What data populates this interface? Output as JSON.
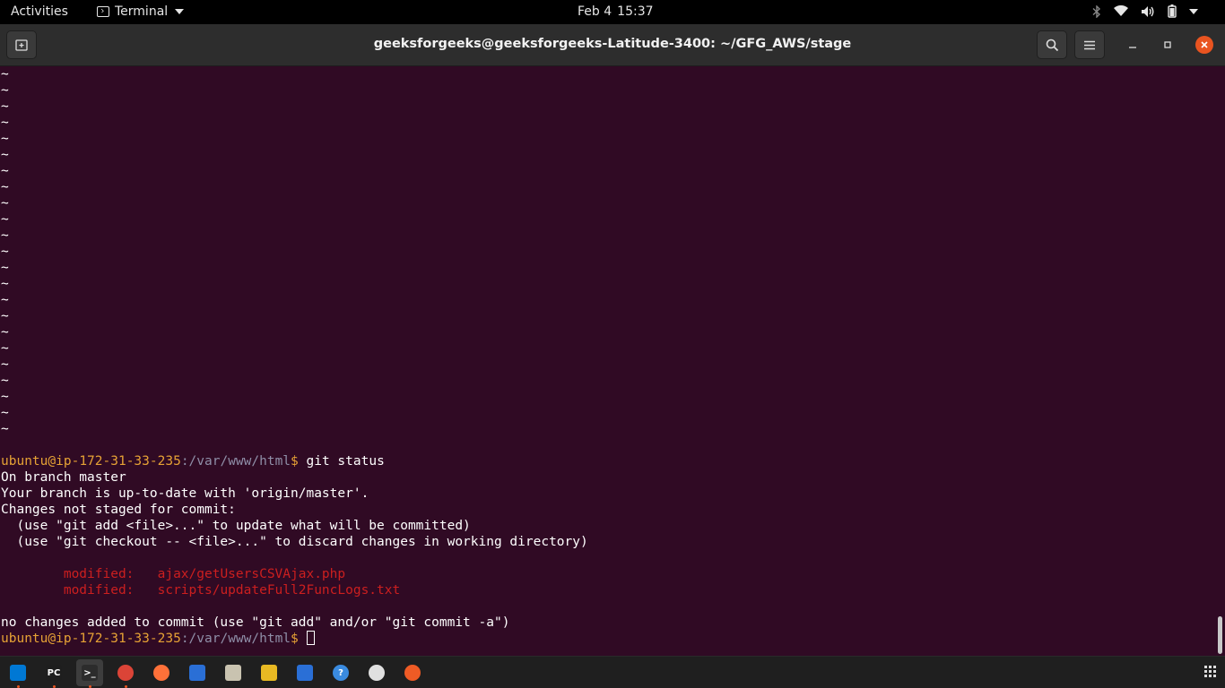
{
  "topbar": {
    "activities": "Activities",
    "app_name": "Terminal",
    "date": "Feb 4",
    "time": "15:37"
  },
  "window": {
    "title": "geeksforgeeks@geeksforgeeks-Latitude-3400: ~/GFG_AWS/stage"
  },
  "terminal": {
    "tilde_char": "~",
    "tilde_count": 23,
    "prompt": {
      "user": "ubuntu",
      "at": "@",
      "host": "ip-172-31-33-235",
      "colon": ":",
      "path": "/var/www/html",
      "dollar": "$"
    },
    "command": " git status",
    "output": [
      "On branch master",
      "Your branch is up-to-date with 'origin/master'.",
      "Changes not staged for commit:",
      "  (use \"git add <file>...\" to update what will be committed)",
      "  (use \"git checkout -- <file>...\" to discard changes in working directory)",
      ""
    ],
    "modified": [
      {
        "label": "        modified:   ",
        "file": "ajax/getUsersCSVAjax.php"
      },
      {
        "label": "        modified:   ",
        "file": "scripts/updateFull2FuncLogs.txt"
      }
    ],
    "footer": "no changes added to commit (use \"git add\" and/or \"git commit -a\")"
  },
  "dock": {
    "items": [
      {
        "name": "vscode-icon",
        "letter": "",
        "color": "#0078d4",
        "running": true
      },
      {
        "name": "pycharm-icon",
        "letter": "PC",
        "color": "#1e1e1e",
        "running": true
      },
      {
        "name": "terminal-icon",
        "letter": ">_",
        "color": "#2c2c2c",
        "running": true,
        "active": true
      },
      {
        "name": "chrome-icon",
        "letter": "",
        "color": "#db4437",
        "running": true
      },
      {
        "name": "firefox-icon",
        "letter": "",
        "color": "#ff7139",
        "running": false
      },
      {
        "name": "thunderbird-icon",
        "letter": "",
        "color": "#2a6fd6",
        "running": false
      },
      {
        "name": "files-icon",
        "letter": "",
        "color": "#c9c3b0",
        "running": false
      },
      {
        "name": "rhythmbox-icon",
        "letter": "",
        "color": "#e8b923",
        "running": false
      },
      {
        "name": "writer-icon",
        "letter": "",
        "color": "#2a6fd6",
        "running": false
      },
      {
        "name": "help-icon",
        "letter": "?",
        "color": "#3a8be0",
        "running": false
      },
      {
        "name": "software-icon",
        "letter": "",
        "color": "#e0e0e0",
        "running": false
      },
      {
        "name": "postman-icon",
        "letter": "",
        "color": "#ef5b25",
        "running": false
      }
    ]
  }
}
